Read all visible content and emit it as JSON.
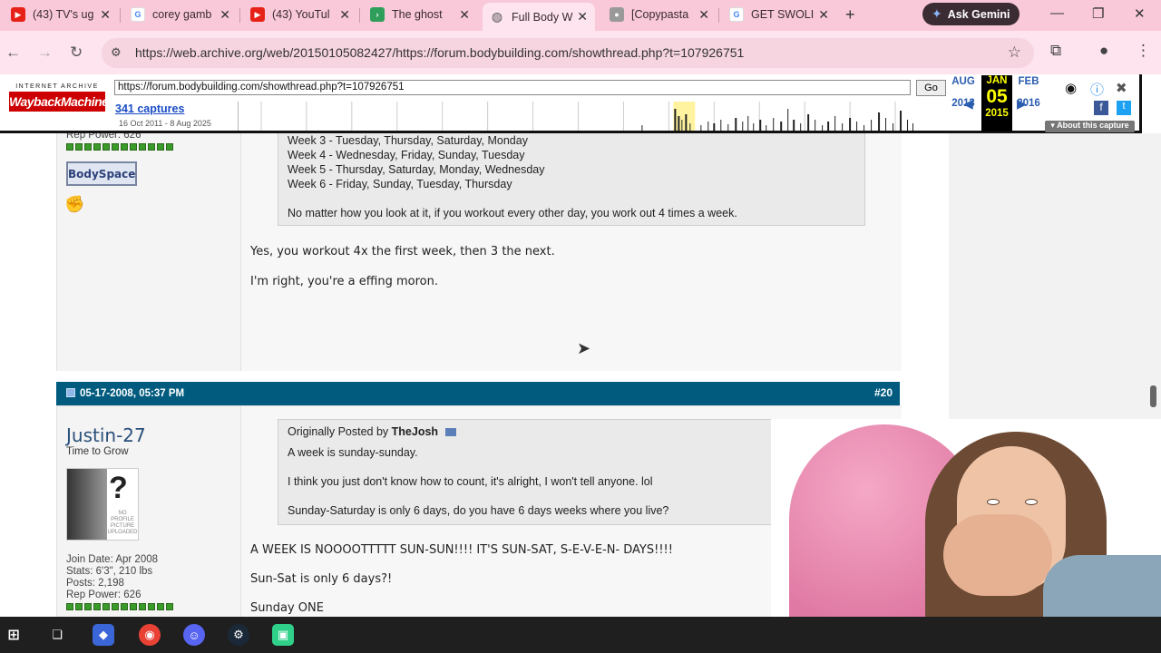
{
  "tabs": [
    {
      "title": "(43) TV's ug",
      "favicon": "youtube-icon"
    },
    {
      "title": "corey gamb",
      "favicon": "google-icon"
    },
    {
      "title": "(43) YouTul",
      "favicon": "youtube-icon"
    },
    {
      "title": "The ghost",
      "favicon": "play-icon"
    },
    {
      "title": "Full Body W",
      "favicon": "globe-icon",
      "active": true
    },
    {
      "title": "[Copypasta",
      "favicon": "reddit-icon"
    },
    {
      "title": "GET SWOLI",
      "favicon": "google-icon"
    }
  ],
  "gemini_label": "Ask Gemini",
  "address_bar": {
    "url": "https://web.archive.org/web/20150105082427/https://forum.bodybuilding.com/showthread.php?t=107926751"
  },
  "wayback": {
    "logo_top": "INTERNET ARCHIVE",
    "logo_main": "WaybackMachine",
    "url_value": "https://forum.bodybuilding.com/showthread.php?t=107926751",
    "go_label": "Go",
    "captures": "341 captures",
    "range": "16 Oct 2011 - 8 Aug 2025",
    "prev_month": "AUG",
    "prev_year": "2013",
    "cur_month": "JAN",
    "cur_day": "05",
    "cur_year": "2015",
    "next_month": "FEB",
    "next_year": "2016",
    "about_label": "▾ About this capture"
  },
  "post1": {
    "rep_power": "Rep Power: 626",
    "bodyspace_label": "BodySpace",
    "quote_lines": [
      "Week 3 - Tuesday, Thursday, Saturday, Monday",
      "Week 4 - Wednesday, Friday, Sunday, Tuesday",
      "Week 5 - Thursday, Saturday, Monday, Wednesday",
      "Week 6 - Friday, Sunday, Tuesday, Thursday",
      "No matter how you look at it, if you workout every other day, you work out 4 times a week."
    ],
    "message_lines": [
      "Yes, you workout 4x the first week, then 3 the next.",
      "I'm right, you're a effing moron."
    ]
  },
  "post2": {
    "date": "05-17-2008, 05:37 PM",
    "post_number": "#20",
    "username": "Justin-27",
    "user_title": "Time to Grow",
    "avatar_text": "NO PROFILE PICTURE UPLOADED",
    "join_date": "Join Date: Apr 2008",
    "stats": "Stats: 6'3\", 210 lbs",
    "posts": "Posts: 2,198",
    "rep_power": "Rep Power: 626",
    "quote_prefix": "Originally Posted by",
    "quote_author": "TheJosh",
    "quote_lines": [
      "A week is sunday-sunday.",
      "I think you just don't know how to count, it's alright, I won't tell anyone. lol",
      "Sunday-Saturday is only 6 days, do you have 6 days weeks where you live?"
    ],
    "message_lines": [
      "A WEEK IS NOOOOTTTTT SUN-SUN!!!! IT'S SUN-SAT, S-E-V-E-N- DAYS!!!!",
      "Sun-Sat is only 6 days?!",
      "Sunday ONE"
    ]
  },
  "colors": {
    "tabstrip": "#f9c9d9",
    "post_header": "#005b7f",
    "username": "#2a4f7a"
  }
}
